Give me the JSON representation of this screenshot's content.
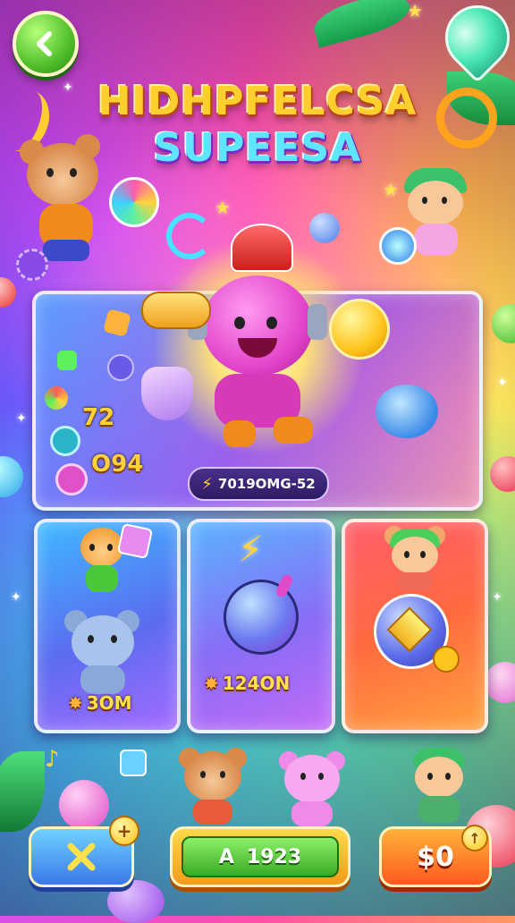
{
  "title": {
    "line1": "HIDHPFELCSA",
    "line2": "SUPEESA"
  },
  "hero": {
    "code_icon": "zap-icon",
    "code": "7019OMG-52",
    "side_value1": "72",
    "side_value2": "O94"
  },
  "cards": [
    {
      "value": "3OM",
      "icon": "burst-icon"
    },
    {
      "value": "124ON",
      "icon": "burst-icon"
    },
    {
      "value": "",
      "icon": "gem-icon"
    }
  ],
  "bottom": {
    "left_button_icon": "close-x-icon",
    "left_badge": "+",
    "mid_letter": "A",
    "mid_value": "1923",
    "cash_value": "$0",
    "cash_badge": "↑"
  },
  "colors": {
    "accent_yellow": "#ffd23c",
    "green": "#4fbf2a",
    "purple": "#6b5cff",
    "orange": "#ff5a1e"
  }
}
